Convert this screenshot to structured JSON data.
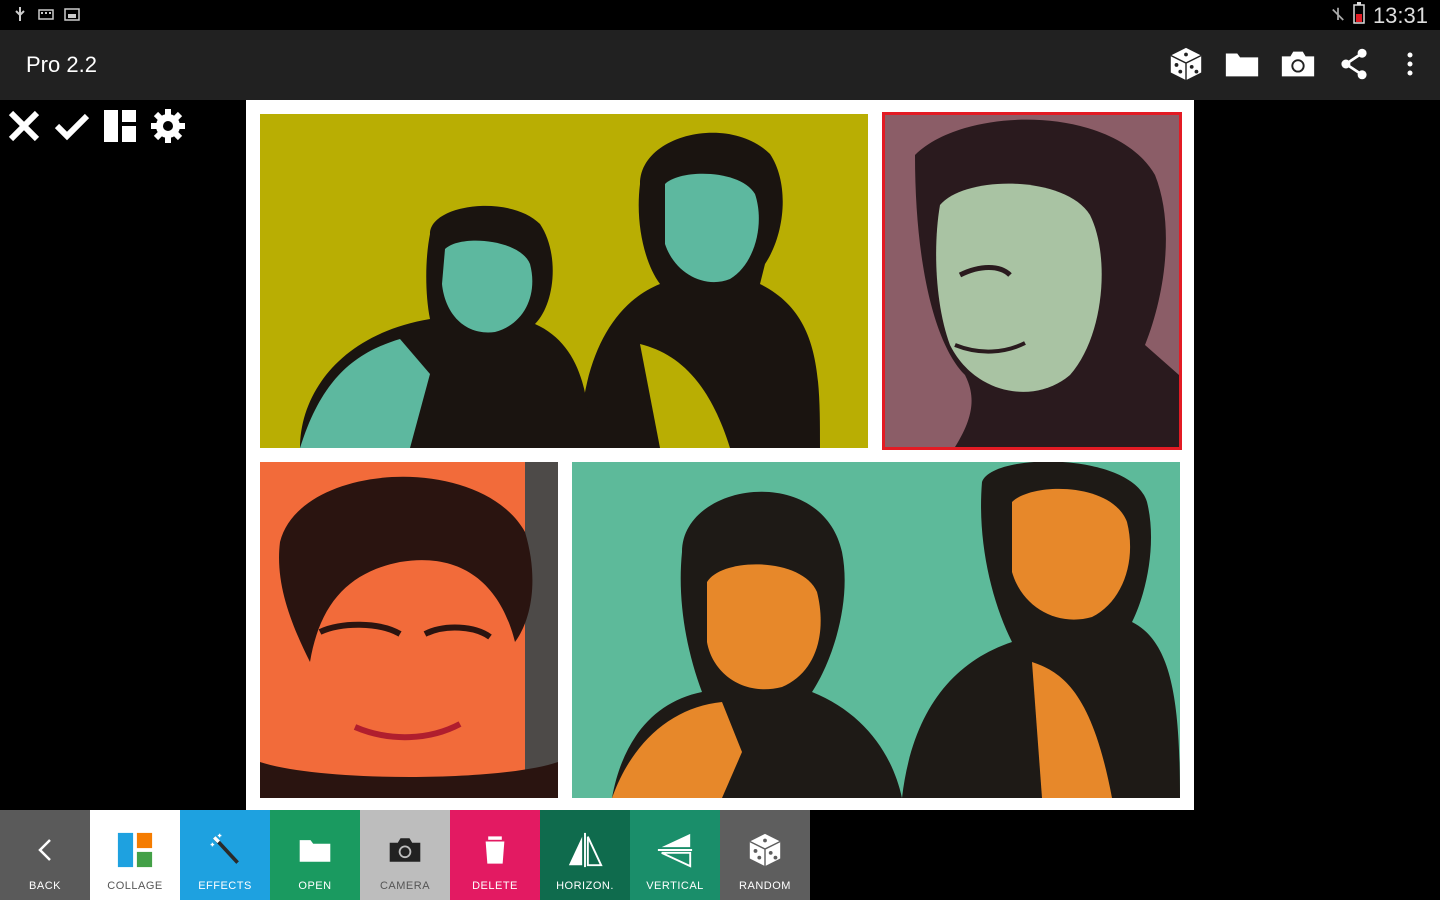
{
  "status_bar": {
    "time": "13:31",
    "left_icons": [
      "usb-icon",
      "keyboard-icon",
      "image-notification-icon"
    ],
    "right_icons": [
      "wifi-off-icon",
      "battery-low-icon"
    ]
  },
  "action_bar": {
    "title": "Pro 2.2",
    "actions": [
      "dice-icon",
      "folder-icon",
      "camera-icon",
      "share-icon",
      "overflow-menu-icon"
    ]
  },
  "tools": [
    "close-icon",
    "checkmark-icon",
    "layout-icon",
    "settings-gear-icon"
  ],
  "collage": {
    "cells": [
      {
        "name": "photo-two-boys-yellow",
        "color": "#b9ae03"
      },
      {
        "name": "photo-boy-portrait-mauve",
        "color": "#8b5d67",
        "selected": true
      },
      {
        "name": "photo-boy-portrait-red",
        "color": "#f26b3a"
      },
      {
        "name": "photo-two-boys-teal",
        "color": "#5dba9a"
      }
    ],
    "selection_color": "#e31b24"
  },
  "bottom_bar": {
    "back": "BACK",
    "collage": "COLLAGE",
    "effects": "EFFECTS",
    "open": "OPEN",
    "camera": "CAMERA",
    "delete": "DELETE",
    "horizon": "HORIZON.",
    "vertical": "VERTICAL",
    "random": "RANDOM"
  }
}
